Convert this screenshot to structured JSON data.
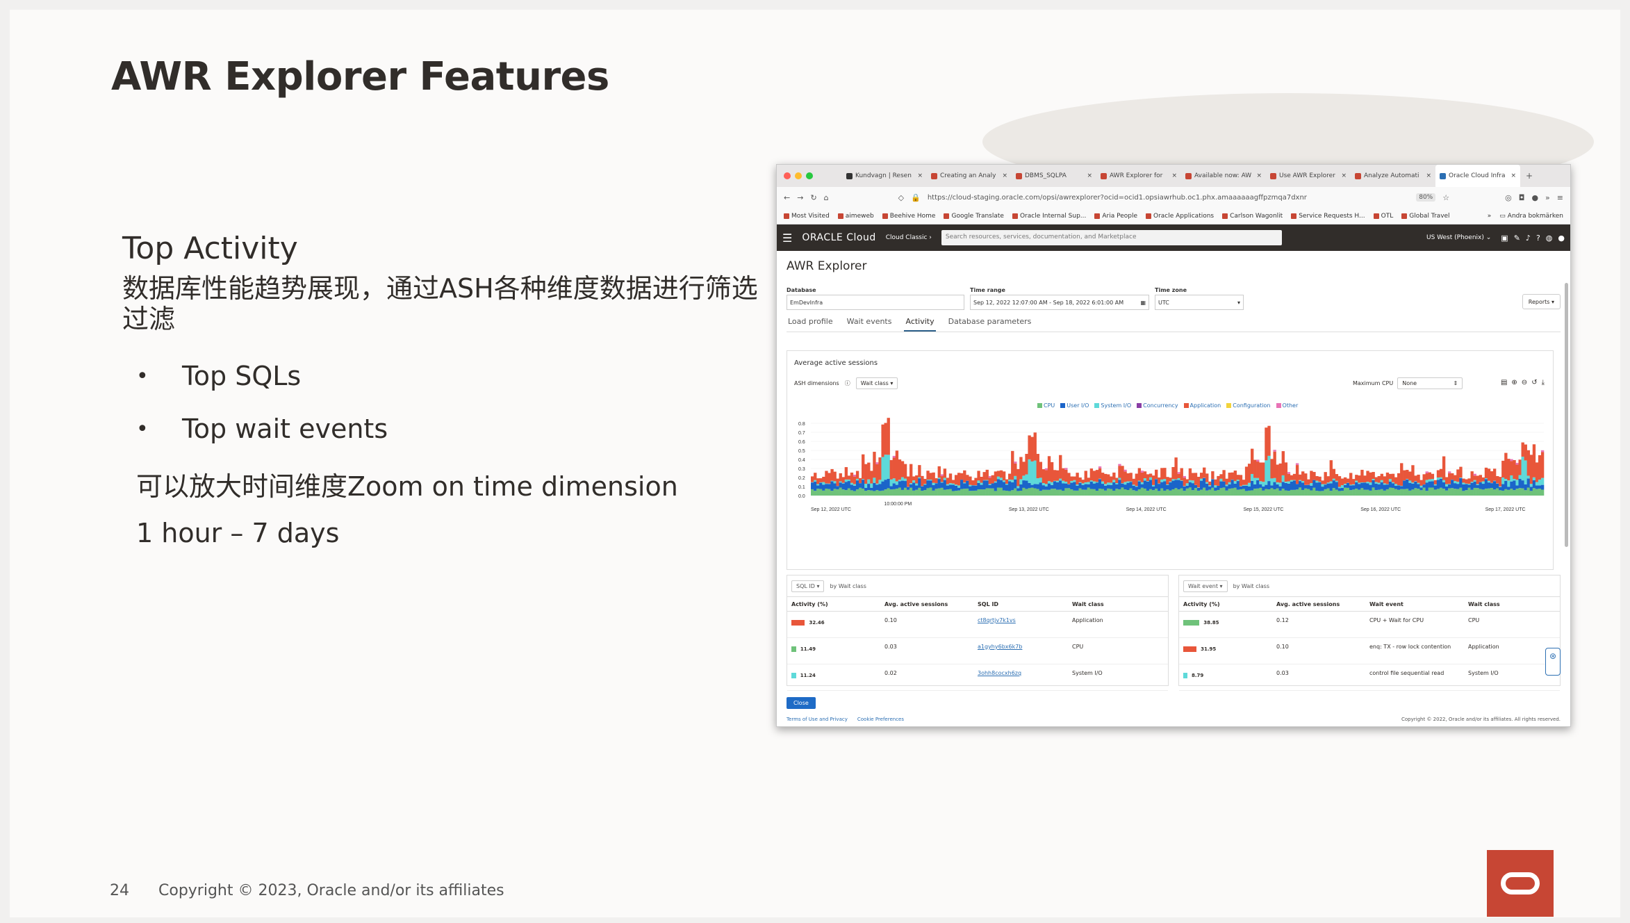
{
  "slide": {
    "title": "AWR Explorer Features",
    "subtitle": "Top Activity",
    "description": "数据库性能趋势展现，通过ASH各种维度数据进行筛选过滤",
    "bullets": [
      "Top SQLs",
      "Top wait events"
    ],
    "zoom_line": "可以放大时间维度Zoom on time dimension",
    "range_line": "1 hour – 7 days",
    "page_number": "24",
    "copyright": "Copyright © 2023, Oracle and/or its affiliates"
  },
  "browser": {
    "tabs": [
      {
        "label": "Kundvagn | Resen",
        "color": "#333333"
      },
      {
        "label": "Creating an Analy",
        "color": "#c74634"
      },
      {
        "label": "DBMS_SQLPA",
        "color": "#c74634"
      },
      {
        "label": "AWR Explorer for",
        "color": "#c74634"
      },
      {
        "label": "Available now: AW",
        "color": "#c74634"
      },
      {
        "label": "Use AWR Explorer",
        "color": "#c74634"
      },
      {
        "label": "Analyze Automati",
        "color": "#c74634"
      },
      {
        "label": "Oracle Cloud Infra",
        "color": "#2c6fb3"
      }
    ],
    "url": "https://cloud-staging.oracle.com/opsi/awrexplorer?ocid=ocid1.opsiawrhub.oc1.phx.amaaaaaagffpzmqa7dxnr",
    "zoom": "80%",
    "bookmarks": [
      "Most Visited",
      "aimeweb",
      "Beehive Home",
      "Google Translate",
      "Oracle Internal Sup...",
      "Aria People",
      "Oracle Applications",
      "Carlson Wagonlit",
      "Service Requests H...",
      "OTL",
      "Global Travel"
    ],
    "bookmarks_other": "Andra bokmärken"
  },
  "oci": {
    "logo": "ORACLE Cloud",
    "classic": "Cloud Classic",
    "search_placeholder": "Search resources, services, documentation, and Marketplace",
    "region": "US West (Phoenix)"
  },
  "awr": {
    "page_title": "AWR Explorer",
    "database_label": "Database",
    "database_value": "EmDevInfra",
    "time_range_label": "Time range",
    "time_range_value": "Sep 12, 2022 12:07:00 AM - Sep 18, 2022 6:01:00 AM",
    "time_zone_label": "Time zone",
    "time_zone_value": "UTC",
    "reports_label": "Reports",
    "subtabs": [
      "Load profile",
      "Wait events",
      "Activity",
      "Database parameters"
    ],
    "active_subtab": "Activity",
    "panel_title": "Average active sessions",
    "ash_dimensions_label": "ASH dimensions",
    "ash_dimensions_value": "Wait class",
    "max_cpu_label": "Maximum CPU",
    "max_cpu_value": "None",
    "close_label": "Close",
    "footer_links": [
      "Terms of Use and Privacy",
      "Cookie Preferences"
    ],
    "footer_copyright": "Copyright © 2022, Oracle and/or its affiliates. All rights reserved."
  },
  "chart_data": {
    "type": "area",
    "stacked": true,
    "series": [
      {
        "name": "CPU",
        "color": "#6fc27a"
      },
      {
        "name": "User I/O",
        "color": "#1b64c9"
      },
      {
        "name": "System I/O",
        "color": "#5ed9d9"
      },
      {
        "name": "Concurrency",
        "color": "#8a3ea5"
      },
      {
        "name": "Application",
        "color": "#e8563a"
      },
      {
        "name": "Configuration",
        "color": "#f2d33c"
      },
      {
        "name": "Other",
        "color": "#e873b6"
      }
    ],
    "yticks": [
      "0.8",
      "0.7",
      "0.6",
      "0.5",
      "0.4",
      "0.3",
      "0.2",
      "0.1",
      "0.0"
    ],
    "ylim": [
      0,
      0.8
    ],
    "xticks": [
      "Sep 12, 2022 UTC",
      "10:00:00 PM",
      "Sep 13, 2022 UTC",
      "Sep 14, 2022 UTC",
      "Sep 15, 2022 UTC",
      "Sep 16, 2022 UTC",
      "Sep 17, 2022 UTC"
    ],
    "peaks": [
      {
        "label": "Sep 12",
        "value": 0.72
      },
      {
        "label": "Sep 13",
        "value": 0.65
      },
      {
        "label": "Sep 15",
        "value": 0.68
      },
      {
        "label": "Sep 17",
        "value": 0.5
      }
    ]
  },
  "sql_table": {
    "dim_label": "SQL ID",
    "by_label": "by Wait class",
    "headers": [
      "Activity (%)",
      "Avg. active sessions",
      "SQL ID",
      "Wait class"
    ],
    "rows": [
      {
        "activity": "32.46",
        "color": "#e8563a",
        "aas": "0.10",
        "sql_id": "ct8qrtjv7k1vs",
        "wait_class": "Application"
      },
      {
        "activity": "11.49",
        "color": "#6fc27a",
        "aas": "0.03",
        "sql_id": "a1gyhy6bx6k7b",
        "wait_class": "CPU"
      },
      {
        "activity": "11.24",
        "color": "#5ed9d9",
        "aas": "0.02",
        "sql_id": "3ohh8cocxh6zq",
        "wait_class": "System I/O"
      }
    ]
  },
  "wait_table": {
    "dim_label": "Wait event",
    "by_label": "by Wait class",
    "headers": [
      "Activity (%)",
      "Avg. active sessions",
      "Wait event",
      "Wait class"
    ],
    "rows": [
      {
        "activity": "38.85",
        "color": "#6fc27a",
        "aas": "0.12",
        "event": "CPU + Wait for CPU",
        "wait_class": "CPU"
      },
      {
        "activity": "31.95",
        "color": "#e8563a",
        "aas": "0.10",
        "event": "enq: TX - row lock contention",
        "wait_class": "Application"
      },
      {
        "activity": "8.79",
        "color": "#5ed9d9",
        "aas": "0.03",
        "event": "control file sequential read",
        "wait_class": "System I/O"
      }
    ]
  }
}
